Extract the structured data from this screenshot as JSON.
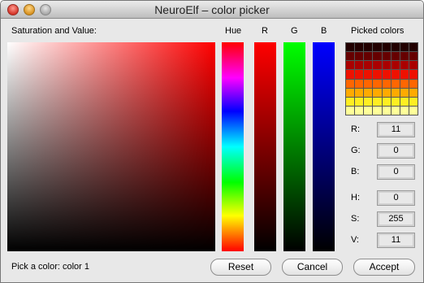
{
  "window": {
    "title": "NeuroElf – color picker",
    "controls": [
      "close",
      "minimize",
      "zoom"
    ]
  },
  "labels": {
    "sv": "Saturation and Value:",
    "hue": "Hue",
    "r": "R",
    "g": "G",
    "b": "B",
    "picked": "Picked colors",
    "status": "Pick a color: color 1"
  },
  "fields": [
    {
      "label": "R:",
      "value": "11"
    },
    {
      "label": "G:",
      "value": "0"
    },
    {
      "label": "B:",
      "value": "0"
    },
    {
      "label": "H:",
      "value": "0"
    },
    {
      "label": "S:",
      "value": "255"
    },
    {
      "label": "V:",
      "value": "11"
    }
  ],
  "picked_colors": [
    "#220000",
    "#220000",
    "#220000",
    "#220000",
    "#220000",
    "#220000",
    "#220000",
    "#220000",
    "#660000",
    "#660000",
    "#660000",
    "#660000",
    "#660000",
    "#660000",
    "#660000",
    "#660000",
    "#aa0000",
    "#aa0000",
    "#aa0000",
    "#aa0000",
    "#aa0000",
    "#aa0000",
    "#aa0000",
    "#aa0000",
    "#ee1100",
    "#ee1100",
    "#ee1100",
    "#ee1100",
    "#ee1100",
    "#ee1100",
    "#ee1100",
    "#ee1100",
    "#ff6600",
    "#ff6600",
    "#ff6600",
    "#ff6600",
    "#ff6600",
    "#ff6600",
    "#ff6600",
    "#ff6600",
    "#ffaa00",
    "#ffaa00",
    "#ffaa00",
    "#ffaa00",
    "#ffaa00",
    "#ffaa00",
    "#ffaa00",
    "#ffaa00",
    "#ffee22",
    "#ffee22",
    "#ffee22",
    "#ffee22",
    "#ffee22",
    "#ffee22",
    "#ffee22",
    "#ffee22",
    "#ffff99",
    "#ffff99",
    "#ffff99",
    "#ffff99",
    "#ffff99",
    "#ffff99",
    "#ffff99",
    "#ffff99"
  ],
  "buttons": {
    "reset": "Reset",
    "cancel": "Cancel",
    "accept": "Accept"
  }
}
